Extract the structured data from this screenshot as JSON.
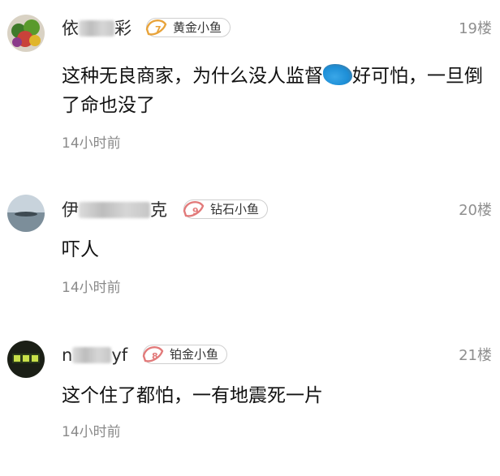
{
  "comments": [
    {
      "name_prefix": "依",
      "name_suffix": "彩",
      "badge": "黄金小鱼",
      "badge_color": "#e8a33a",
      "floor": "19楼",
      "text_part1": "这种无良商家，为什么没人监督",
      "text_part2": "好可怕，一旦倒了命也没了",
      "time": "14小时前"
    },
    {
      "name_prefix": "伊",
      "name_suffix": "克",
      "badge": "钻石小鱼",
      "badge_color": "#e27a7a",
      "floor": "20楼",
      "text_part1": "吓人",
      "time": "14小时前"
    },
    {
      "name_prefix": "n",
      "name_suffix": "yf",
      "badge": "铂金小鱼",
      "badge_color": "#e27a7a",
      "floor": "21楼",
      "text_part1": "这个住了都怕，一有地震死一片",
      "time": "14小时前"
    }
  ]
}
